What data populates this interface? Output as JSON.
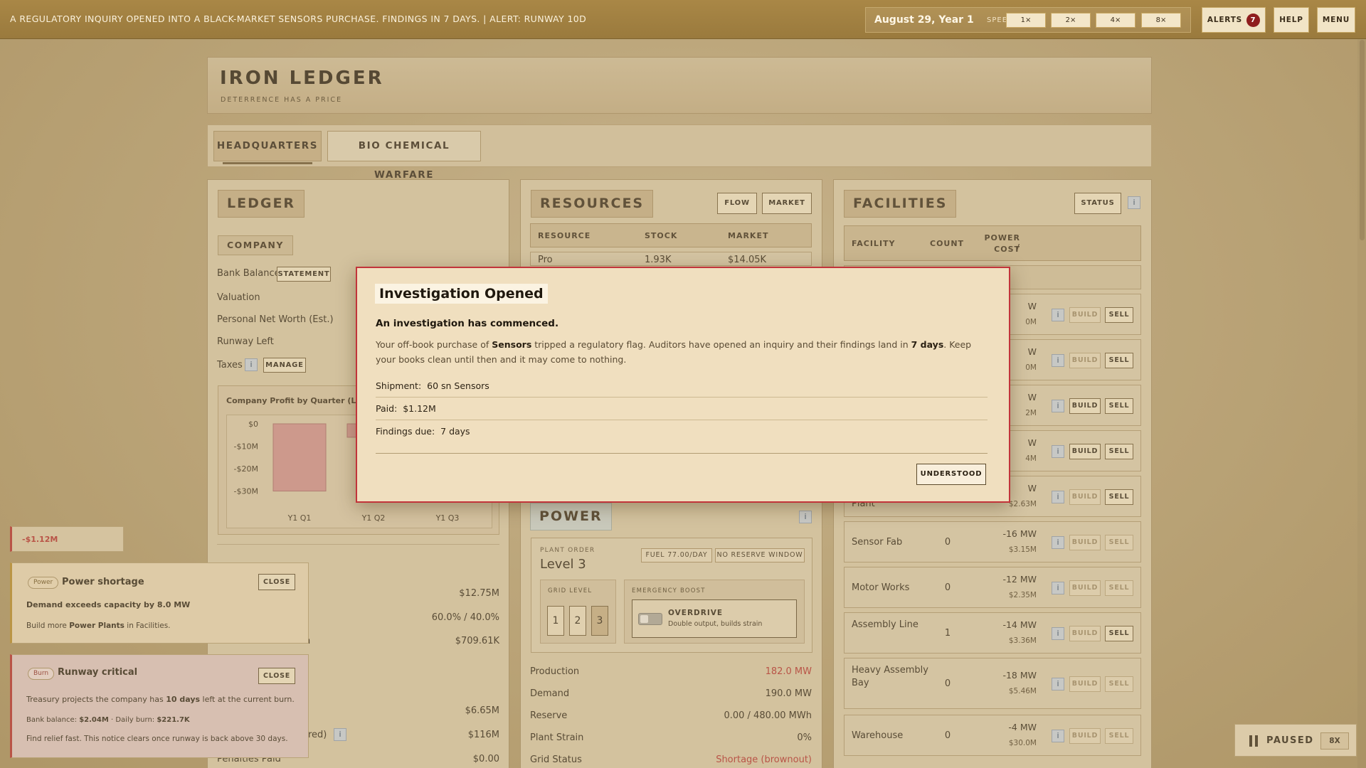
{
  "topbar": {
    "ticker": "A REGULATORY INQUIRY OPENED INTO A BLACK-MARKET SENSORS PURCHASE. FINDINGS IN 7 DAYS. | ALERT: RUNWAY 10D",
    "date": "August 29, Year 1",
    "speed_label": "SPEED",
    "speeds": [
      "1×",
      "2×",
      "4×",
      "8×"
    ],
    "alerts_label": "ALERTS",
    "alerts_count": "7",
    "help_label": "HELP",
    "menu_label": "MENU"
  },
  "game": {
    "title": "IRON LEDGER",
    "subtitle": "DETERRENCE HAS A PRICE"
  },
  "tabs": [
    {
      "label": "HEADQUARTERS"
    },
    {
      "label": "BIO CHEMICAL WARFARE"
    }
  ],
  "ledger": {
    "title": "LEDGER",
    "company_head": "COMPANY",
    "rows": {
      "bank_balance": "Bank Balance",
      "valuation": "Valuation",
      "net_worth": "Personal Net Worth (Est.)",
      "runway": "Runway Left",
      "taxes": "Taxes"
    },
    "statement_btn": "STATEMENT",
    "manage_btn": "MANAGE",
    "chart_title": "Company Profit by Quarter (Last 6 Qu",
    "values": {
      "v1": "$12.75M",
      "v2": "60.0% / 40.0%",
      "v3": "$709.61K",
      "v4": "$6.65M",
      "v5": "$116M",
      "v6": "$0.00"
    },
    "partial_labels": {
      "ered": "ered)",
      "penalties": "Penalties Paid",
      "n": "n"
    }
  },
  "chart_data": {
    "type": "bar",
    "title": "Company Profit by Quarter (Last 6 Qu",
    "categories": [
      "Y1 Q1",
      "Y1 Q2",
      "Y1 Q3"
    ],
    "values": [
      -30,
      -6,
      0
    ],
    "yticks": [
      "$0",
      "-$10M",
      "-$20M",
      "-$30M"
    ],
    "ylim": [
      -33,
      0
    ],
    "color": "#cf8f8d"
  },
  "resources": {
    "title": "RESOURCES",
    "flow_btn": "FLOW",
    "market_btn": "MARKET",
    "col_resource": "RESOURCE",
    "col_stock": "STOCK",
    "col_market": "MARKET",
    "first_row": {
      "name": "Pro",
      "stock": "1.93K",
      "market": "$14.05K"
    }
  },
  "facilities": {
    "title": "FACILITIES",
    "status_btn": "STATUS",
    "col_facility": "FACILITY",
    "col_count": "COUNT",
    "col_power": "POWER /",
    "col_cost": "COST",
    "build_label": "BUILD",
    "sell_label": "SELL",
    "info_label": "i",
    "rows": [
      {
        "name": "",
        "count": "",
        "power": "W",
        "cost": "0M",
        "build_enabled": false,
        "sell_enabled": true
      },
      {
        "name": "",
        "count": "",
        "power": "W",
        "cost": "0M",
        "build_enabled": false,
        "sell_enabled": true
      },
      {
        "name": "",
        "count": "",
        "power": "W",
        "cost": "2M",
        "build_enabled": true,
        "sell_enabled": true
      },
      {
        "name": "",
        "count": "",
        "power": "W",
        "cost": "4M",
        "build_enabled": true,
        "sell_enabled": true
      },
      {
        "name": "Plant",
        "count": "",
        "power": "W",
        "cost": "$2.63M",
        "build_enabled": false,
        "sell_enabled": true
      },
      {
        "name": "Sensor Fab",
        "count": "0",
        "power": "-16 MW",
        "cost": "$3.15M",
        "build_enabled": false,
        "sell_enabled": false
      },
      {
        "name": "Motor Works",
        "count": "0",
        "power": "-12 MW",
        "cost": "$2.35M",
        "build_enabled": false,
        "sell_enabled": false
      },
      {
        "name": "Assembly Line",
        "count": "1",
        "power": "-14 MW",
        "cost": "$3.36M",
        "build_enabled": false,
        "sell_enabled": true
      },
      {
        "name": "Heavy Assembly Bay",
        "count": "0",
        "power": "-18 MW",
        "cost": "$5.46M",
        "build_enabled": false,
        "sell_enabled": false
      },
      {
        "name": "Warehouse",
        "count": "0",
        "power": "-4 MW",
        "cost": "$30.0M",
        "build_enabled": false,
        "sell_enabled": false
      }
    ]
  },
  "power": {
    "title": "POWER",
    "plant_order_label": "PLANT ORDER",
    "level": "Level 3",
    "fuel_pill": "FUEL 77.00/DAY",
    "reserve_pill": "NO RESERVE WINDOW",
    "grid_level_label": "GRID LEVEL",
    "grid_levels": [
      "1",
      "2",
      "3"
    ],
    "selected_level": 3,
    "emergency_label": "EMERGENCY BOOST",
    "overdrive_title": "OVERDRIVE",
    "overdrive_desc": "Double output, builds strain",
    "stats": {
      "production_label": "Production",
      "production": "182.0 MW",
      "demand_label": "Demand",
      "demand": "190.0 MW",
      "reserve_label": "Reserve",
      "reserve": "0.00 / 480.00 MWh",
      "strain_label": "Plant Strain",
      "strain": "0%",
      "grid_label": "Grid Status",
      "grid": "Shortage (brownout)"
    },
    "alert_color": "#b3302d"
  },
  "notifications": {
    "mini": "-$1.12M",
    "power_toast": {
      "tag": "Power",
      "title": "Power shortage",
      "close": "CLOSE",
      "line1": "Demand exceeds capacity by 8.0 MW",
      "line2_pre": "Build more ",
      "line2_bold": "Power Plants",
      "line2_post": " in Facilities."
    },
    "burn_toast": {
      "tag": "Burn",
      "title": "Runway critical",
      "close": "CLOSE",
      "line1_pre": "Treasury projects the company has ",
      "line1_bold": "10 days",
      "line1_post": " left at the current burn.",
      "bal_label": "Bank balance: ",
      "bal_value": "$2.04M",
      "burn_label": " · Daily burn: ",
      "burn_value": "$221.7K",
      "line3": "Find relief fast. This notice clears once runway is back above 30 days."
    }
  },
  "paused": {
    "label": "PAUSED",
    "speed": "8X"
  },
  "modal": {
    "title": "Investigation Opened",
    "lead": "An investigation has commenced.",
    "body_1": "Your off-book purchase of ",
    "body_bold1": "Sensors",
    "body_2": " tripped a regulatory flag. Auditors have opened an inquiry and their findings land in ",
    "body_bold2": "7 days",
    "body_3": ". Keep your books clean until then and it may come to nothing.",
    "shipment_label": "Shipment:",
    "shipment_value": "60 sn Sensors",
    "paid_label": "Paid:",
    "paid_value": "$1.12M",
    "findings_label": "Findings due:",
    "findings_value": "7 days",
    "button": "UNDERSTOOD"
  }
}
